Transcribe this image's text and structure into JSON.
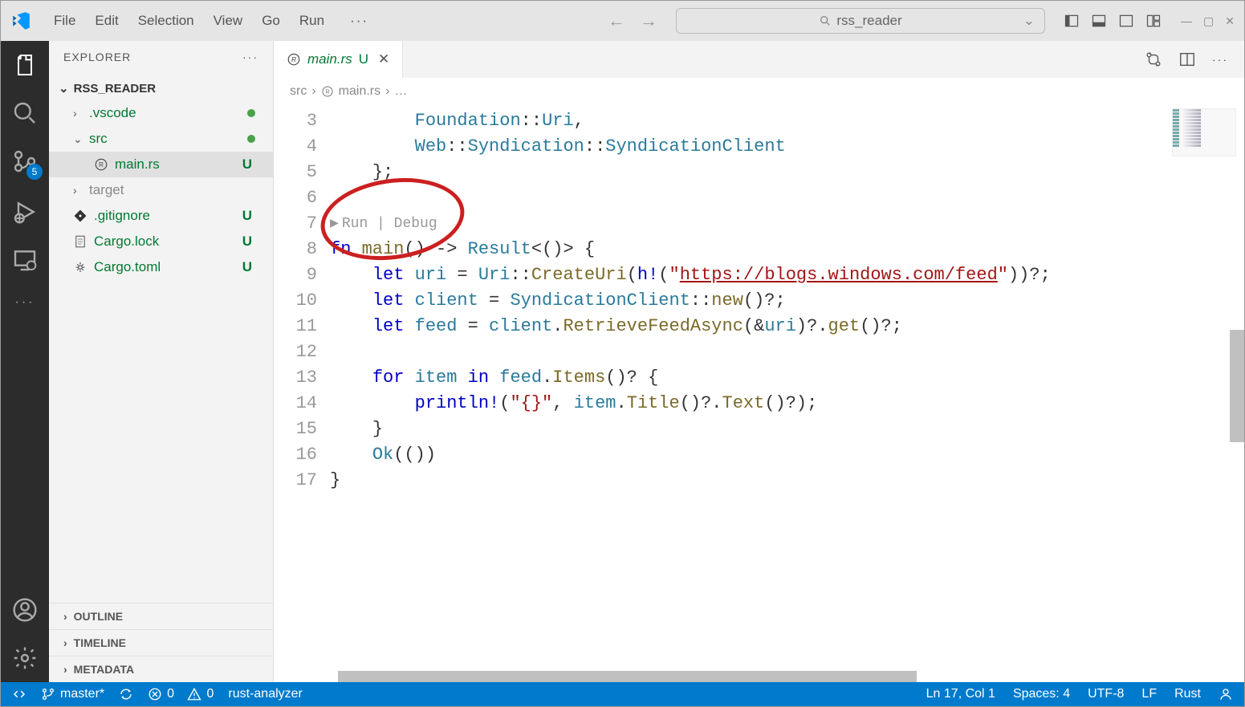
{
  "titlebar": {
    "menu": [
      "File",
      "Edit",
      "Selection",
      "View",
      "Go",
      "Run"
    ],
    "search_text": "rss_reader"
  },
  "sidebar": {
    "title": "EXPLORER",
    "root": "RSS_READER",
    "scm_badge": "5",
    "tree": [
      {
        "label": ".vscode",
        "kind": "folder",
        "chevron": "›",
        "dot": true
      },
      {
        "label": "src",
        "kind": "folder",
        "chevron": "⌄",
        "dot": true
      },
      {
        "label": "main.rs",
        "kind": "file",
        "icon": "rust",
        "status": "U",
        "selected": true,
        "deep": true
      },
      {
        "label": "target",
        "kind": "folder",
        "chevron": "›",
        "target": true
      },
      {
        "label": ".gitignore",
        "kind": "file",
        "icon": "git",
        "status": "U"
      },
      {
        "label": "Cargo.lock",
        "kind": "file",
        "icon": "lines",
        "status": "U"
      },
      {
        "label": "Cargo.toml",
        "kind": "file",
        "icon": "gear",
        "status": "U"
      }
    ],
    "collapsed": [
      "OUTLINE",
      "TIMELINE",
      "METADATA"
    ]
  },
  "tab": {
    "filename": "main.rs",
    "status": "U"
  },
  "breadcrumb": {
    "folder": "src",
    "file": "main.rs",
    "tail": "…"
  },
  "codelens": {
    "run": "Run",
    "debug": "Debug"
  },
  "code": {
    "lines": [
      "3",
      "4",
      "5",
      "6",
      "",
      "7",
      "8",
      "9",
      "10",
      "11",
      "12",
      "13",
      "14",
      "15",
      "16",
      "17"
    ],
    "l3_indent": "        ",
    "l3_foundation": "Foundation",
    "l3_sep": "::",
    "l3_uri": "Uri",
    "l3_comma": ",",
    "l4_indent": "        ",
    "l4_web": "Web",
    "l4_synd_mod": "Syndication",
    "l4_synd_client": "SyndicationClient",
    "l5_indent": "    ",
    "l5_brace": "};",
    "l7_fn": "fn ",
    "l7_main": "main",
    "l7_sig1": "() -> ",
    "l7_result": "Result",
    "l7_sig2": "<()> {",
    "l8_indent": "    ",
    "l8_let": "let ",
    "l8_uri_var": "uri",
    "l8_eq": " = ",
    "l8_uri_type": "Uri",
    "l8_create": "CreateUri",
    "l8_open": "(",
    "l8_h": "h!",
    "l8_popen": "(",
    "l8_q1": "\"",
    "l8_url": "https://blogs.windows.com/feed",
    "l8_q2": "\"",
    "l8_pclose": "))?;",
    "l9_indent": "    ",
    "l9_let": "let ",
    "l9_client": "client",
    "l9_eq": " = ",
    "l9_sc": "SyndicationClient",
    "l9_new": "new",
    "l9_tail": "()?;",
    "l10_indent": "    ",
    "l10_let": "let ",
    "l10_feed": "feed",
    "l10_eq": " = ",
    "l10_client": "client",
    "l10_dot": ".",
    "l10_rfa": "RetrieveFeedAsync",
    "l10_args": "(&",
    "l10_uri": "uri",
    "l10_mid": ")?.",
    "l10_get": "get",
    "l10_tail": "()?;",
    "l12_indent": "    ",
    "l12_for": "for ",
    "l12_item": "item",
    "l12_in": " in ",
    "l12_feed": "feed",
    "l12_dot": ".",
    "l12_items": "Items",
    "l12_tail": "()? {",
    "l13_indent": "        ",
    "l13_println": "println!",
    "l13_open": "(",
    "l13_fmt": "\"{}\"",
    "l13_comma": ", ",
    "l13_item": "item",
    "l13_dot1": ".",
    "l13_title": "Title",
    "l13_mid": "()?.",
    "l13_text": "Text",
    "l13_tail": "()?);",
    "l14_indent": "    ",
    "l14_brace": "}",
    "l15_indent": "    ",
    "l15_ok": "Ok",
    "l15_tail": "(())",
    "l16_brace": "}"
  },
  "statusbar": {
    "branch": "master*",
    "errors": "0",
    "warnings": "0",
    "analyzer": "rust-analyzer",
    "position": "Ln 17, Col 1",
    "spaces": "Spaces: 4",
    "encoding": "UTF-8",
    "eol": "LF",
    "lang": "Rust"
  }
}
